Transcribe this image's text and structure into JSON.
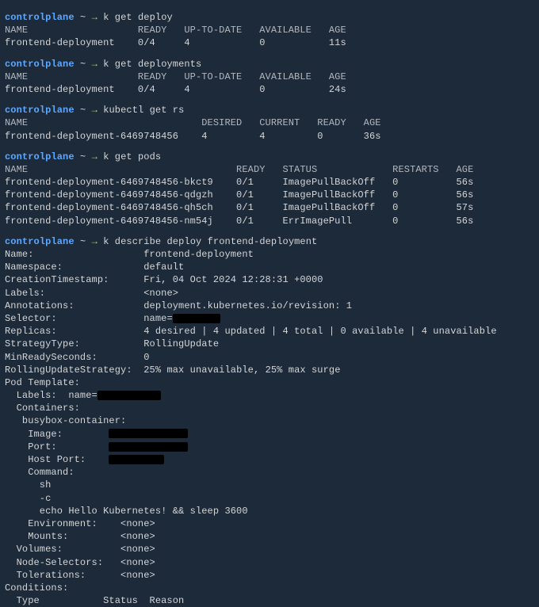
{
  "prompt": {
    "host": "controlplane",
    "tilde": "~",
    "arrow": "→"
  },
  "b1": {
    "cmd": "k get deploy",
    "hdr": "NAME                   READY   UP-TO-DATE   AVAILABLE   AGE",
    "row": "frontend-deployment    0/4     4            0           11s"
  },
  "b2": {
    "cmd": "k get deployments",
    "hdr": "NAME                   READY   UP-TO-DATE   AVAILABLE   AGE",
    "row": "frontend-deployment    0/4     4            0           24s"
  },
  "b3": {
    "cmd": "kubectl get rs",
    "hdr": "NAME                              DESIRED   CURRENT   READY   AGE",
    "row": "frontend-deployment-6469748456    4         4         0       36s"
  },
  "b4": {
    "cmd": "k get pods",
    "hdr": "NAME                                    READY   STATUS             RESTARTS   AGE",
    "r1": "frontend-deployment-6469748456-bkct9    0/1     ImagePullBackOff   0          56s",
    "r2": "frontend-deployment-6469748456-qdgzh    0/1     ImagePullBackOff   0          56s",
    "r3": "frontend-deployment-6469748456-qh5ch    0/1     ImagePullBackOff   0          57s",
    "r4": "frontend-deployment-6469748456-nm54j    0/1     ErrImagePull       0          56s"
  },
  "b5": {
    "cmd": "k describe deploy frontend-deployment",
    "f01k": "Name:",
    "f01v": "frontend-deployment",
    "f02k": "Namespace:",
    "f02v": "default",
    "f03k": "CreationTimestamp:",
    "f03v": "Fri, 04 Oct 2024 12:28:31 +0000",
    "f04k": "Labels:",
    "f04v": "<none>",
    "f05k": "Annotations:",
    "f05v": "deployment.kubernetes.io/revision: 1",
    "f06k": "Selector:",
    "f06v": "name=",
    "f07k": "Replicas:",
    "f07v": "4 desired | 4 updated | 4 total | 0 available | 4 unavailable",
    "f08k": "StrategyType:",
    "f08v": "RollingUpdate",
    "f09k": "MinReadySeconds:",
    "f09v": "0",
    "f10k": "RollingUpdateStrategy:",
    "f10v": "25% max unavailable, 25% max surge",
    "pt": "Pod Template:",
    "ptLabels": "  Labels:  name=",
    "ptContainers": "  Containers:",
    "ptCont": "   busybox-container:",
    "ptImg": "    Image:",
    "ptPort": "    Port:",
    "ptHostPort": "    Host Port:",
    "ptCmd": "    Command:",
    "ptCmd1": "      sh",
    "ptCmd2": "      -c",
    "ptCmd3": "      echo Hello Kubernetes! && sleep 3600",
    "ptEnv": "    Environment:    <none>",
    "ptMnt": "    Mounts:         <none>",
    "ptVol": "  Volumes:          <none>",
    "ptNS": "  Node-Selectors:   <none>",
    "ptTol": "  Tolerations:      <none>",
    "cond": "Conditions:",
    "condHdr": "  Type           Status  Reason"
  }
}
